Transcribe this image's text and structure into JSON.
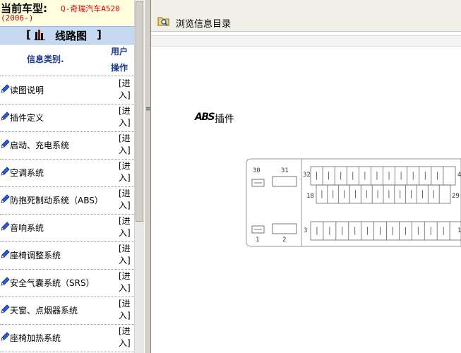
{
  "car": {
    "label": "当前车型:",
    "model": "Q-奇瑞汽车A520",
    "year": "(2006-)"
  },
  "section": {
    "open_bracket": "[",
    "title": "线路图",
    "close_bracket": "]"
  },
  "columns": {
    "type": "信息类别.",
    "user": "用户",
    "op": "操作"
  },
  "items": [
    {
      "label": "读图说明",
      "enter_a": "[进",
      "enter_b": "入]"
    },
    {
      "label": "插件定义",
      "enter_a": "[进",
      "enter_b": "入]"
    },
    {
      "label": "启动、充电系统",
      "enter_a": "[进",
      "enter_b": "入]"
    },
    {
      "label": "空调系统",
      "enter_a": "[进",
      "enter_b": "入]"
    },
    {
      "label": "防抱死制动系统（ABS）",
      "enter_a": "[进",
      "enter_b": "入]"
    },
    {
      "label": "音响系统",
      "enter_a": "[进",
      "enter_b": "入]"
    },
    {
      "label": "座椅调整系统",
      "enter_a": "[进",
      "enter_b": "入]"
    },
    {
      "label": "安全气囊系统（SRS）",
      "enter_a": "[进",
      "enter_b": "入]"
    },
    {
      "label": "天窗、点烟器系统",
      "enter_a": "[进",
      "enter_b": "入]"
    },
    {
      "label": "座椅加热系统",
      "enter_a": "[进",
      "enter_b": "入]"
    }
  ],
  "splitter": {
    "grip": "≡"
  },
  "right": {
    "title": "浏览信息目录",
    "abs_logo": "ABS",
    "abs_caption": "插件"
  },
  "connector": {
    "pins": {
      "p30": "30",
      "p31": "31",
      "p32": "32",
      "p4": "4",
      "p18": "18",
      "p29": "29",
      "p1": "1",
      "p2": "2",
      "p3": "3",
      "p1b": "1"
    }
  }
}
